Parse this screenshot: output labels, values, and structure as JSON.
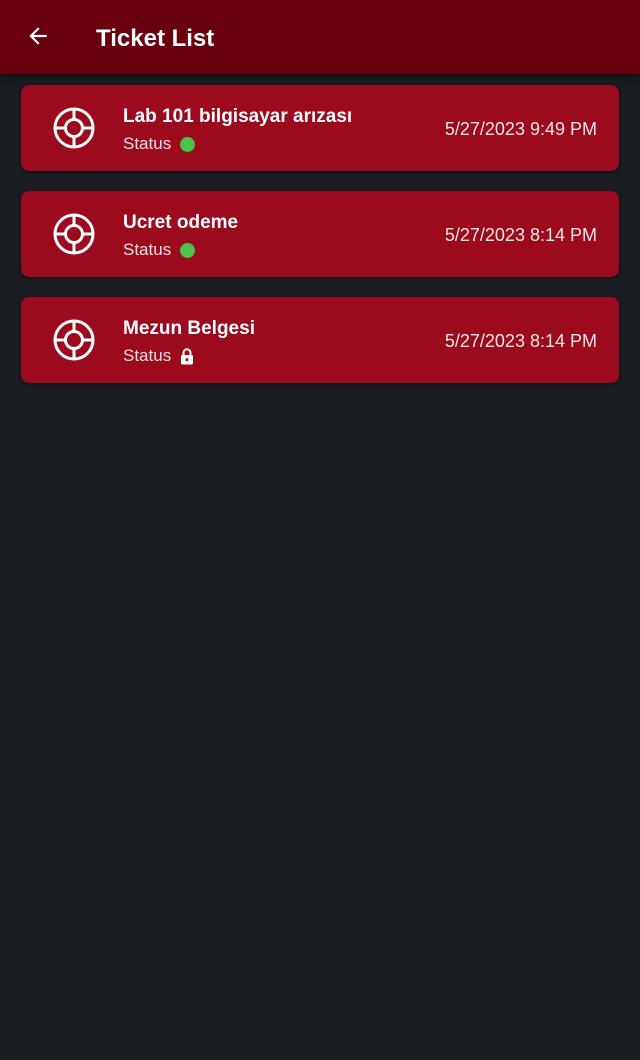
{
  "app_bar": {
    "title": "Ticket List",
    "back_icon": "arrow-left-icon",
    "background_color": "#68000f"
  },
  "theme": {
    "page_background": "#1a1d21",
    "card_background": "#9b0a1d",
    "status_open_color": "#4cc24a"
  },
  "tickets": [
    {
      "icon": "lifebuoy-icon",
      "title": "Lab 101 bilgisayar arızası",
      "status_label": "Status",
      "status": "open",
      "status_icon": "green-dot-icon",
      "date": "5/27/2023 9:49 PM"
    },
    {
      "icon": "lifebuoy-icon",
      "title": "Ucret odeme",
      "status_label": "Status",
      "status": "open",
      "status_icon": "green-dot-icon",
      "date": "5/27/2023 8:14 PM"
    },
    {
      "icon": "lifebuoy-icon",
      "title": "Mezun Belgesi",
      "status_label": "Status",
      "status": "closed",
      "status_icon": "lock-icon",
      "date": "5/27/2023 8:14 PM"
    }
  ]
}
